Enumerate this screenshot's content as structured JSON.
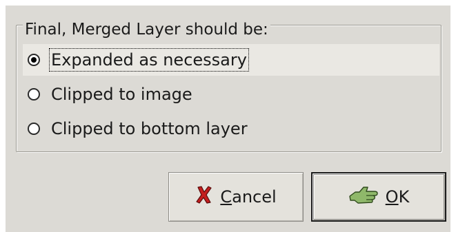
{
  "frame": {
    "legend": "Final, Merged Layer should be:"
  },
  "options": [
    {
      "label": "Expanded as necessary",
      "checked": true
    },
    {
      "label": "Clipped to image",
      "checked": false
    },
    {
      "label": "Clipped to bottom layer",
      "checked": false
    }
  ],
  "buttons": {
    "cancel": {
      "mnemonic": "C",
      "rest": "ancel",
      "icon": "cancel-x-icon"
    },
    "ok": {
      "mnemonic": "O",
      "rest": "K",
      "icon": "ok-hand-icon"
    }
  },
  "colors": {
    "dialog_bg": "#dcdad5",
    "selected_row_bg": "#eae8e3",
    "cancel_icon": "#c41e1e",
    "ok_icon": "#8fb86a"
  }
}
